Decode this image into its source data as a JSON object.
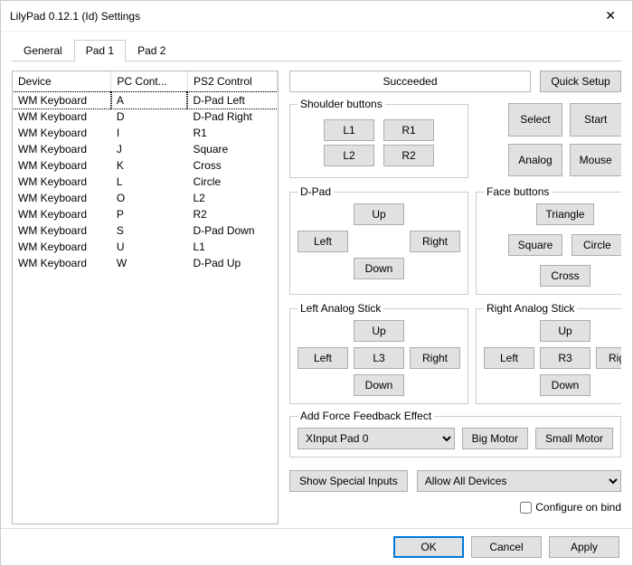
{
  "window": {
    "title": "LilyPad 0.12.1 (Id) Settings",
    "close": "✕"
  },
  "tabs": {
    "general": "General",
    "pad1": "Pad 1",
    "pad2": "Pad 2",
    "active": "pad1"
  },
  "table": {
    "headers": {
      "device": "Device",
      "pc": "PC Cont...",
      "ps2": "PS2 Control"
    },
    "rows": [
      {
        "device": "WM Keyboard",
        "pc": "A",
        "ps2": "D-Pad Left",
        "selected": true
      },
      {
        "device": "WM Keyboard",
        "pc": "D",
        "ps2": "D-Pad Right"
      },
      {
        "device": "WM Keyboard",
        "pc": "I",
        "ps2": "R1"
      },
      {
        "device": "WM Keyboard",
        "pc": "J",
        "ps2": "Square"
      },
      {
        "device": "WM Keyboard",
        "pc": "K",
        "ps2": "Cross"
      },
      {
        "device": "WM Keyboard",
        "pc": "L",
        "ps2": "Circle"
      },
      {
        "device": "WM Keyboard",
        "pc": "O",
        "ps2": "L2"
      },
      {
        "device": "WM Keyboard",
        "pc": "P",
        "ps2": "R2"
      },
      {
        "device": "WM Keyboard",
        "pc": "S",
        "ps2": "D-Pad Down"
      },
      {
        "device": "WM Keyboard",
        "pc": "U",
        "ps2": "L1"
      },
      {
        "device": "WM Keyboard",
        "pc": "W",
        "ps2": "D-Pad Up"
      }
    ]
  },
  "status": "Succeeded",
  "buttons": {
    "quick_setup": "Quick Setup",
    "l1": "L1",
    "r1": "R1",
    "l2": "L2",
    "r2": "R2",
    "select": "Select",
    "start": "Start",
    "analog": "Analog",
    "mouse": "Mouse",
    "up": "Up",
    "down": "Down",
    "left": "Left",
    "right": "Right",
    "triangle": "Triangle",
    "square": "Square",
    "circle": "Circle",
    "cross": "Cross",
    "l3": "L3",
    "r3": "R3",
    "big_motor": "Big Motor",
    "small_motor": "Small Motor",
    "show_special": "Show Special Inputs",
    "ok": "OK",
    "cancel": "Cancel",
    "apply": "Apply"
  },
  "groups": {
    "shoulder": "Shoulder buttons",
    "dpad": "D-Pad",
    "face": "Face buttons",
    "left_stick": "Left Analog Stick",
    "right_stick": "Right Analog Stick",
    "ffb": "Add Force Feedback Effect"
  },
  "ffb_device": {
    "selected": "XInput Pad 0",
    "options": [
      "XInput Pad 0"
    ]
  },
  "device_filter": {
    "selected": "Allow All Devices",
    "options": [
      "Allow All Devices"
    ]
  },
  "configure_on_bind": {
    "label": "Configure on bind",
    "checked": false
  }
}
